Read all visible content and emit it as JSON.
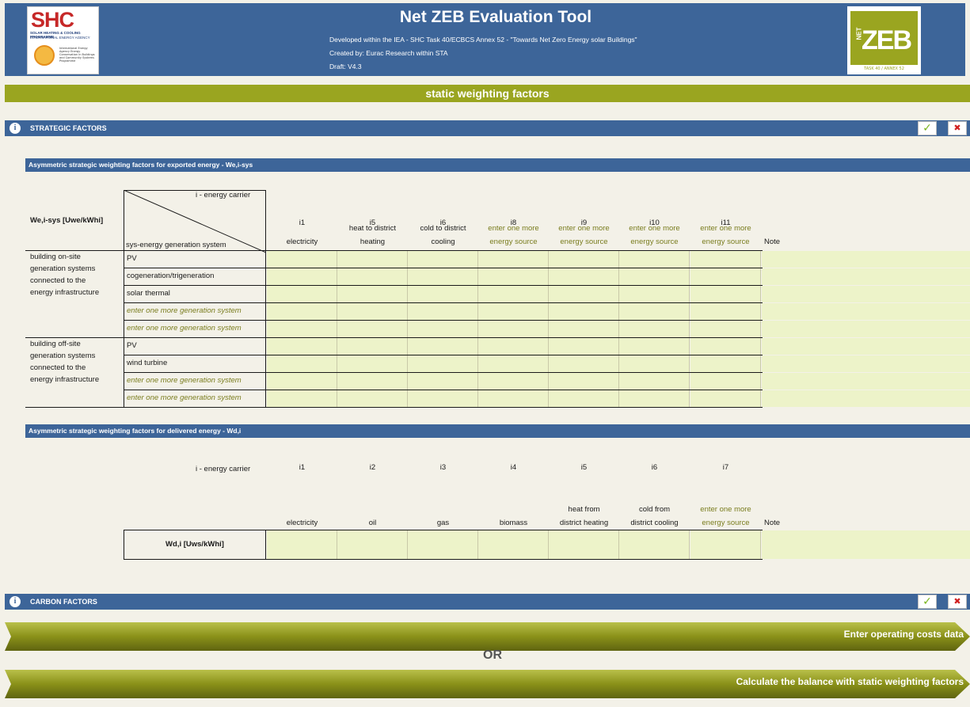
{
  "header": {
    "title": "Net ZEB Evaluation Tool",
    "line1": "Developed within the IEA - SHC Task 40/ECBCS Annex 52 - \"Towards Net Zero Energy solar Buildings\"",
    "line2": "Created by: Eurac Research within STA",
    "line3": "Draft: V4.3",
    "shc_logo": {
      "title": "SHC",
      "subtitle": "SOLAR HEATING & COOLING PROGRAMME",
      "agency": "INTERNATIONAL ENERGY AGENCY",
      "text": "International Energy Agency Energy Conservation in Buildings and Community Systems Programme"
    },
    "zeb_logo": {
      "net": "NET",
      "text": "ZEB",
      "footer": "TASK 40 / ANNEX 52"
    }
  },
  "banner": "static weighting factors",
  "strategic": {
    "label": "STRATEGIC FACTORS",
    "ok_icon": "✓",
    "close_icon": "✖"
  },
  "exported": {
    "title": "Asymmetric strategic weighting  factors  for exported energy - We,i-sys",
    "unit_label": "We,i-sys [Uwe/kWhi]",
    "diag_top": "i - energy carrier",
    "diag_bottom": "sys-energy generation system",
    "carrier_ids": [
      "i1",
      "i5",
      "i6",
      "i8",
      "i9",
      "i10",
      "i11"
    ],
    "carrier_names": [
      {
        "l1": "",
        "l2": "electricity",
        "olive": false
      },
      {
        "l1": "heat to district",
        "l2": "heating",
        "olive": false
      },
      {
        "l1": "cold to district",
        "l2": "cooling",
        "olive": false
      },
      {
        "l1": "enter one more",
        "l2": "energy source",
        "olive": true
      },
      {
        "l1": "enter one more",
        "l2": "energy source",
        "olive": true
      },
      {
        "l1": "enter one more",
        "l2": "energy source",
        "olive": true
      },
      {
        "l1": "enter one more",
        "l2": "energy source",
        "olive": true
      }
    ],
    "note": "Note",
    "group1": [
      "building on-site",
      "generation systems",
      "connected to the",
      "energy infrastructure"
    ],
    "group2": [
      "building off-site",
      "generation systems",
      "connected to the",
      "energy infrastructure"
    ],
    "rows1": [
      {
        "label": "PV",
        "placeholder": false
      },
      {
        "label": "cogeneration/trigeneration",
        "placeholder": false
      },
      {
        "label": "solar thermal",
        "placeholder": false
      },
      {
        "label": "enter one more generation system",
        "placeholder": true
      },
      {
        "label": "enter one more generation system",
        "placeholder": true
      }
    ],
    "rows2": [
      {
        "label": "PV",
        "placeholder": false
      },
      {
        "label": "wind turbine",
        "placeholder": false
      },
      {
        "label": "enter one more generation system",
        "placeholder": true
      },
      {
        "label": "enter one more generation system",
        "placeholder": true
      }
    ]
  },
  "delivered": {
    "title": "Asymmetric strategic weighting factors for delivered energy - Wd,i",
    "carrier_label": "i - energy carrier",
    "carrier_ids": [
      "i1",
      "i2",
      "i3",
      "i4",
      "i5",
      "i6",
      "i7"
    ],
    "carrier_names": [
      {
        "l1": "",
        "l2": "electricity",
        "olive": false
      },
      {
        "l1": "",
        "l2": "oil",
        "olive": false
      },
      {
        "l1": "",
        "l2": "gas",
        "olive": false
      },
      {
        "l1": "",
        "l2": "biomass",
        "olive": false
      },
      {
        "l1": "heat from",
        "l2": "district heating",
        "olive": false
      },
      {
        "l1": "cold from",
        "l2": "district cooling",
        "olive": false
      },
      {
        "l1": "enter one more",
        "l2": "energy source",
        "olive": true
      }
    ],
    "note": "Note",
    "row_label": "Wd,i [Uws/kWhi]"
  },
  "carbon": {
    "label": "CARBON FACTORS",
    "ok_icon": "✓",
    "close_icon": "✖"
  },
  "actions": {
    "enter_costs": "Enter operating costs data",
    "or": "OR",
    "calculate": "Calculate the balance with static weighting factors"
  },
  "colors": {
    "header_blue": "#3d6599",
    "olive": "#9aa520",
    "cell": "#edf3c9",
    "bg": "#f3f1e8"
  }
}
